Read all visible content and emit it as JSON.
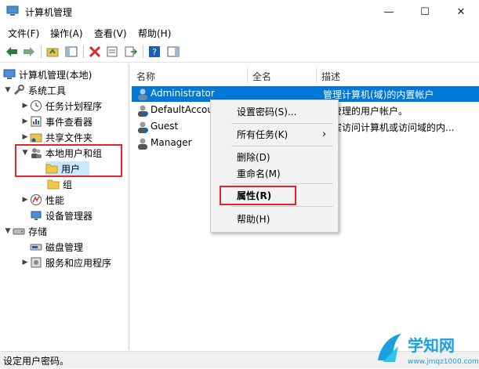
{
  "window": {
    "title": "计算机管理"
  },
  "window_controls": {
    "minimize": "—",
    "maximize": "☐",
    "close": "✕"
  },
  "menu": [
    "文件(F)",
    "操作(A)",
    "查看(V)",
    "帮助(H)"
  ],
  "tree": {
    "root": "计算机管理(本地)",
    "items": [
      {
        "label": "系统工具"
      },
      {
        "label": "任务计划程序"
      },
      {
        "label": "事件查看器"
      },
      {
        "label": "共享文件夹"
      },
      {
        "label": "本地用户和组"
      },
      {
        "label": "用户"
      },
      {
        "label": "组"
      },
      {
        "label": "性能"
      },
      {
        "label": "设备管理器"
      },
      {
        "label": "存储"
      },
      {
        "label": "磁盘管理"
      },
      {
        "label": "服务和应用程序"
      }
    ]
  },
  "list": {
    "columns": [
      "名称",
      "全名",
      "描述"
    ],
    "rows": [
      {
        "name": "Administrator",
        "fullname": "",
        "desc": "管理计算机(域)的内置帐户"
      },
      {
        "name": "DefaultAccou",
        "fullname": "",
        "desc": "统管理的用户帐户。"
      },
      {
        "name": "Guest",
        "fullname": "",
        "desc": "来宾访问计算机或访问域的内..."
      },
      {
        "name": "Manager",
        "fullname": "",
        "desc": ""
      }
    ]
  },
  "context_menu": {
    "set_password": "设置密码(S)...",
    "all_tasks": "所有任务(K)",
    "submenu_arrow": "›",
    "delete": "删除(D)",
    "rename": "重命名(M)",
    "properties": "属性(R)",
    "help": "帮助(H)"
  },
  "status": {
    "text": "设定用户密码。"
  },
  "watermark": {
    "brand": "学知网",
    "url": "www.jmqz1000.com"
  },
  "colors": {
    "selection": "#0078d7",
    "tree_selection": "#cce8ff",
    "highlight_box": "#e0262b"
  }
}
